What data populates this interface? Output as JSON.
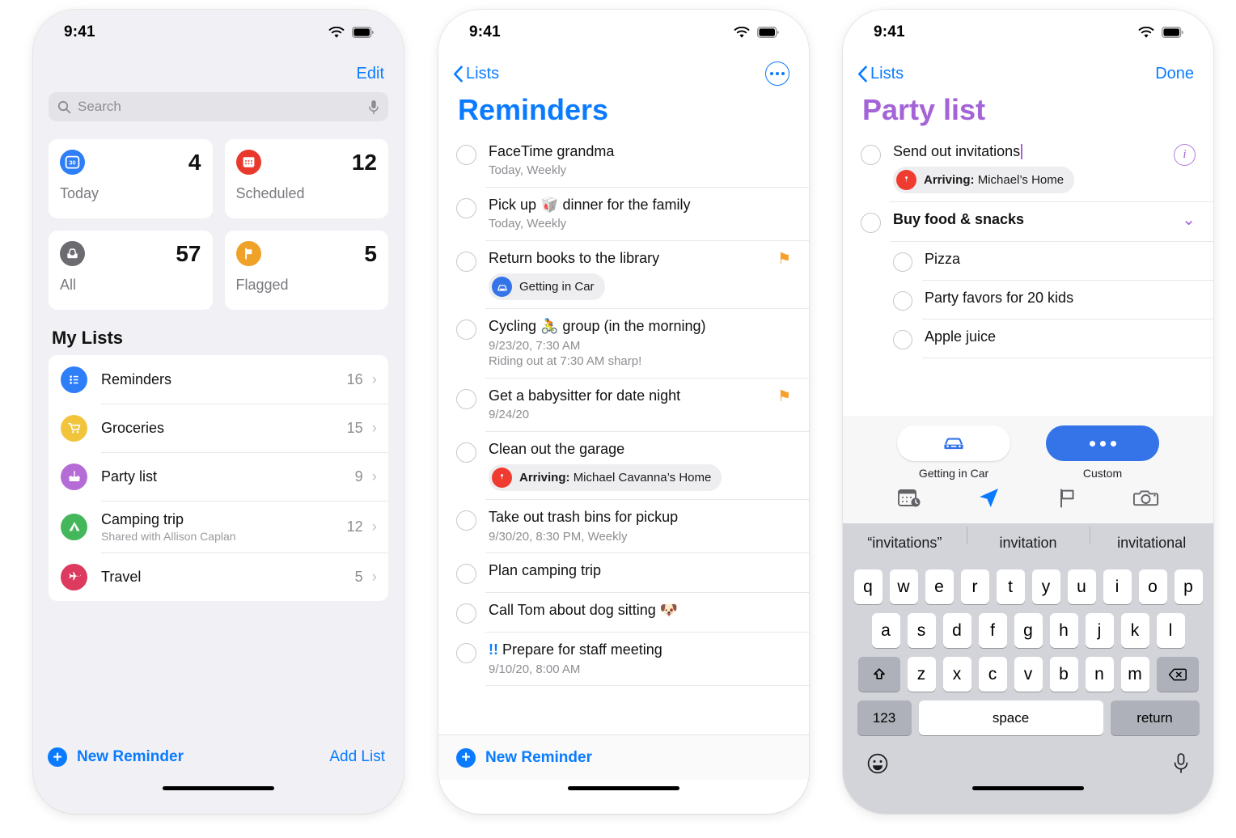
{
  "status_bar": {
    "time": "9:41",
    "wifi_icon": "wifi-icon",
    "battery_icon": "battery-icon"
  },
  "colors": {
    "accent_blue": "#0a7bff",
    "purple": "#a463d6",
    "flag_orange": "#f8a02c",
    "today_blue": "#2d7ef7",
    "scheduled_red": "#e8392c",
    "all_gray": "#6b6b70",
    "flagged_orange": "#f0a128",
    "key_blue": "#3474e8"
  },
  "phone1": {
    "nav": {
      "edit_label": "Edit"
    },
    "search": {
      "placeholder": "Search",
      "icon": "search-icon",
      "mic_icon": "microphone-icon"
    },
    "smart_cards": [
      {
        "label": "Today",
        "count": "4",
        "icon": "calendar-day-icon",
        "color": "#2d7ef7"
      },
      {
        "label": "Scheduled",
        "count": "12",
        "icon": "calendar-icon",
        "color": "#e8392c"
      },
      {
        "label": "All",
        "count": "57",
        "icon": "inbox-tray-icon",
        "color": "#6b6b70"
      },
      {
        "label": "Flagged",
        "count": "5",
        "icon": "flag-icon",
        "color": "#f0a128"
      }
    ],
    "my_lists_header": "My Lists",
    "lists": [
      {
        "name": "Reminders",
        "subtitle": "",
        "count": "16",
        "icon": "bulleted-list-icon",
        "color": "#2d7ef7"
      },
      {
        "name": "Groceries",
        "subtitle": "",
        "count": "15",
        "icon": "shopping-cart-icon",
        "color": "#f1c43c"
      },
      {
        "name": "Party list",
        "subtitle": "",
        "count": "9",
        "icon": "birthday-cake-icon",
        "color": "#b56cd6"
      },
      {
        "name": "Camping trip",
        "subtitle": "Shared with Allison Caplan",
        "count": "12",
        "icon": "tent-icon",
        "color": "#44b75b"
      },
      {
        "name": "Travel",
        "subtitle": "",
        "count": "5",
        "icon": "airplane-icon",
        "color": "#dc3a5e"
      }
    ],
    "footer": {
      "new_reminder": "New Reminder",
      "add_list": "Add List",
      "plus_icon": "plus-circle-icon"
    }
  },
  "phone2": {
    "nav": {
      "back_label": "Lists",
      "back_icon": "chevron-left-icon",
      "more_icon": "ellipsis-circle-icon"
    },
    "title": "Reminders",
    "reminders": [
      {
        "title": "FaceTime grandma",
        "sub": "Today, Weekly",
        "flagged": false,
        "tag": null
      },
      {
        "title": "Pick up 🥡 dinner for the family",
        "sub": "Today, Weekly",
        "flagged": false,
        "tag": null
      },
      {
        "title": "Return books to the library",
        "sub": "",
        "flagged": true,
        "tag": {
          "label": "Getting in Car",
          "icon": "car-icon",
          "color": "#3474e8",
          "bold_prefix": ""
        }
      },
      {
        "title": "Cycling 🚴 group (in the morning)",
        "sub": "9/23/20, 7:30 AM\nRiding out at 7:30 AM sharp!",
        "flagged": false,
        "tag": null
      },
      {
        "title": "Get a babysitter for date night",
        "sub": "9/24/20",
        "flagged": true,
        "tag": null
      },
      {
        "title": "Clean out the garage",
        "sub": "",
        "flagged": false,
        "tag": {
          "label": "Michael Cavanna’s Home",
          "bold_prefix": "Arriving:",
          "icon": "location-pin-icon",
          "color": "#ef3b30"
        }
      },
      {
        "title": "Take out trash bins for pickup",
        "sub": "9/30/20, 8:30 PM, Weekly",
        "flagged": false,
        "tag": null
      },
      {
        "title": "Plan camping trip",
        "sub": "",
        "flagged": false,
        "tag": null
      },
      {
        "title": "Call Tom about dog sitting 🐶",
        "sub": "",
        "flagged": false,
        "tag": null
      },
      {
        "title": "!! Prepare for staff meeting",
        "priority": "!!",
        "title_rest": "Prepare for staff meeting",
        "sub": "9/10/20, 8:00 AM",
        "flagged": false,
        "tag": null
      }
    ],
    "footer": {
      "new_reminder": "New Reminder",
      "plus_icon": "plus-circle-icon"
    }
  },
  "phone3": {
    "nav": {
      "back_label": "Lists",
      "back_icon": "chevron-left-icon",
      "done_label": "Done"
    },
    "title": "Party list",
    "items": [
      {
        "title": "Send out invitations",
        "editing": true,
        "info_icon": "info-circle-icon",
        "tag": {
          "bold_prefix": "Arriving:",
          "label": "Michael’s Home",
          "icon": "location-pin-icon",
          "color": "#ef3b30"
        }
      },
      {
        "title": "Buy food & snacks",
        "bold": true,
        "caret_icon": "chevron-down-icon"
      }
    ],
    "subitems": [
      {
        "title": "Pizza"
      },
      {
        "title": "Party favors for 20 kids"
      },
      {
        "title": "Apple juice"
      }
    ],
    "quickbar": {
      "actions": [
        {
          "label": "Getting in Car",
          "icon": "car-icon",
          "style": "white"
        },
        {
          "label": "Custom",
          "icon": "ellipsis-icon",
          "style": "blue"
        }
      ],
      "icons": [
        {
          "name": "calendar-clock-icon"
        },
        {
          "name": "location-arrow-icon"
        },
        {
          "name": "flag-outline-icon"
        },
        {
          "name": "camera-icon"
        }
      ]
    },
    "keyboard": {
      "suggestions": [
        "“invitations”",
        "invitation",
        "invitational"
      ],
      "row1": [
        "q",
        "w",
        "e",
        "r",
        "t",
        "y",
        "u",
        "i",
        "o",
        "p"
      ],
      "row2": [
        "a",
        "s",
        "d",
        "f",
        "g",
        "h",
        "j",
        "k",
        "l"
      ],
      "row3": [
        "z",
        "x",
        "c",
        "v",
        "b",
        "n",
        "m"
      ],
      "shift_icon": "shift-icon",
      "backspace_icon": "backspace-icon",
      "numbers_key": "123",
      "space_key": "space",
      "return_key": "return",
      "emoji_icon": "emoji-icon",
      "dictation_icon": "microphone-icon"
    }
  }
}
